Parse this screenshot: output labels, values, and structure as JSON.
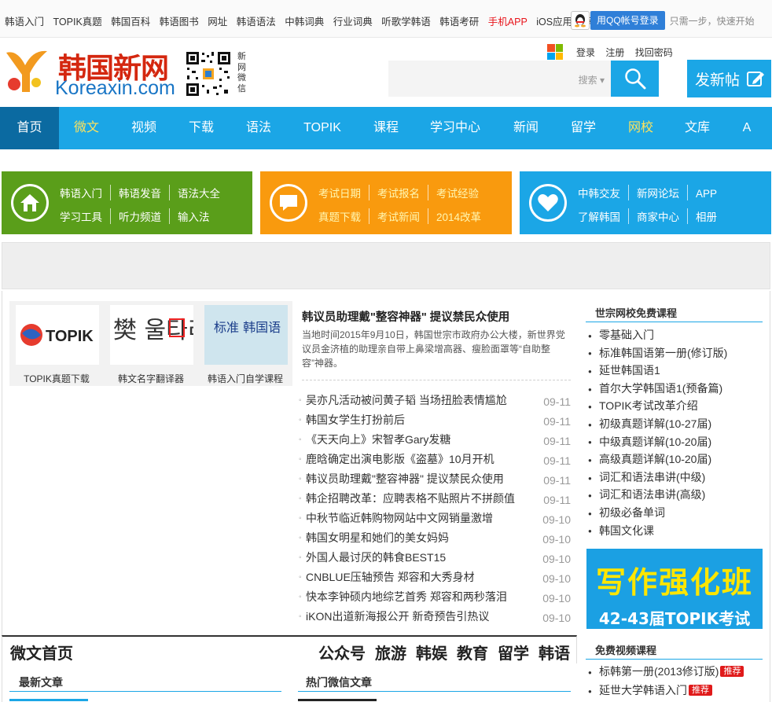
{
  "topbar": {
    "links": [
      "韩语入门",
      "TOPIK真题",
      "韩国百科",
      "韩语图书",
      "网址",
      "韩语语法",
      "中韩词典",
      "行业词典",
      "听歌学韩语",
      "韩语考研",
      "手机APP",
      "iOS应用推荐"
    ],
    "highlight_link": "手机APP",
    "qq_login": "用QQ帐号登录",
    "qq_note": "只需一步，快速开始"
  },
  "header": {
    "logo_cn": "韩国新网",
    "logo_en": "Koreaxin.com",
    "qr_caption": [
      "新",
      "网",
      "微",
      "信"
    ],
    "user_links": [
      "登录",
      "注册",
      "找回密码"
    ],
    "search_selector": "搜索",
    "post_button": "发新帖"
  },
  "nav": {
    "items": [
      "首页",
      "微文",
      "视频",
      "下载",
      "语法",
      "TOPIK",
      "课程",
      "学习中心",
      "新闻",
      "留学",
      "网校",
      "文库",
      "A"
    ],
    "active": "首页",
    "highlighted": [
      "微文",
      "网校"
    ]
  },
  "categories": [
    {
      "color": "#5a9e1a",
      "icon": "home-icon",
      "row1": [
        "韩语入门",
        "韩语发音",
        "语法大全"
      ],
      "row2": [
        "学习工具",
        "听力频道",
        "输入法"
      ]
    },
    {
      "color": "#f99a0e",
      "icon": "chat-bubble-icon",
      "row1": [
        "考试日期",
        "考试报名",
        "考试经验"
      ],
      "row2": [
        "真题下载",
        "考试新闻",
        "2014改革"
      ]
    },
    {
      "color": "#1ba6e6",
      "icon": "heart-icon",
      "row1": [
        "中韩交友",
        "新网论坛",
        "APP"
      ],
      "row2": [
        "了解韩国",
        "商家中心",
        "相册"
      ]
    }
  ],
  "thumbs": [
    {
      "label": "TOPIK真题下载",
      "img_text": "TOPIK"
    },
    {
      "label": "韩文名字翻译器",
      "img_text": "樊 울타리 번"
    },
    {
      "label": "韩语入门自学课程",
      "img_text": "标准 韩国语"
    }
  ],
  "headline": {
    "title": "韩议员助理戴\"整容神器\" 提议禁民众使用",
    "summary": "当地时间2015年9月10日，韩国世宗市政府办公大楼，新世界党议员金济植的助理亲自带上鼻梁增高器、瘦脸面罩等“自助整容”神器。"
  },
  "news": [
    {
      "title": "吴亦凡活动被问黄子韬 当场扭脸表情尴尬",
      "date": "09-11"
    },
    {
      "title": "韩国女学生打扮前后",
      "date": "09-11"
    },
    {
      "title": "《天天向上》宋智孝Gary发糖",
      "date": "09-11"
    },
    {
      "title": "鹿晗确定出演电影版《盗墓》10月开机",
      "date": "09-11"
    },
    {
      "title": "韩议员助理戴\"整容神器\" 提议禁民众使用",
      "date": "09-11"
    },
    {
      "title": "韩企招聘改革：应聘表格不贴照片不拼颜值",
      "date": "09-11"
    },
    {
      "title": "中秋节临近韩购物网站中文网销量激增",
      "date": "09-10"
    },
    {
      "title": "韩国女明星和她们的美女妈妈",
      "date": "09-10"
    },
    {
      "title": "外国人最讨厌的韩食BEST15",
      "date": "09-10"
    },
    {
      "title": "CNBLUE压轴预告 郑容和大秀身材",
      "date": "09-10"
    },
    {
      "title": "快本李钟硕内地综艺首秀 郑容和两秒落泪",
      "date": "09-10"
    },
    {
      "title": "iKON出道新海报公开 新奇预告引热议",
      "date": "09-10"
    }
  ],
  "sidebar": {
    "courses_title": "世宗网校免费课程",
    "courses": [
      "零基础入门",
      "标准韩国语第一册(修订版)",
      "延世韩国语1",
      "首尔大学韩国语1(预备篇)",
      "TOPIK考试改革介绍",
      "初级真题详解(10-27届)",
      "中级真题详解(10-20届)",
      "高级真题详解(10-20届)",
      "词汇和语法串讲(中级)",
      "词汇和语法串讲(高级)",
      "初级必备单词",
      "韩国文化课"
    ],
    "promo_line1": "写作强化班",
    "promo_line2": "42-43届TOPIK考试",
    "video_title": "免费视频课程",
    "videos": [
      {
        "title": "标韩第一册(2013修订版)",
        "badge": "推荐"
      },
      {
        "title": "延世大学韩语入门",
        "badge": "推荐"
      }
    ]
  },
  "weiwen": {
    "title": "微文首页",
    "links": [
      "公众号",
      "旅游",
      "韩娱",
      "教育",
      "留学",
      "韩语"
    ],
    "latest": "最新文章",
    "hot": "热门微信文章"
  }
}
